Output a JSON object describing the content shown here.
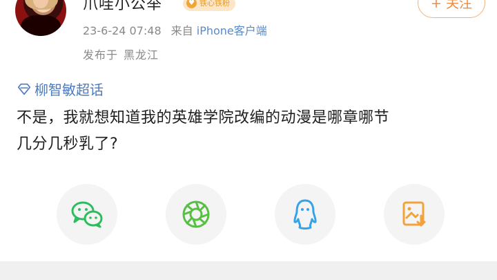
{
  "user": {
    "name": "爪哇小公举",
    "badge": "铁心铁粉"
  },
  "post_meta": {
    "date": "23-6-24 07:48",
    "source_prefix": "来自",
    "source": "iPhone客户端",
    "location_label": "发布于",
    "location": "黑龙江"
  },
  "follow": {
    "label": "+ 关注"
  },
  "topic": {
    "label": "柳智敏超话"
  },
  "post": {
    "line1": "不是，我就想知道我的英雄学院改编的动漫是哪章哪节",
    "line2": "几分几秒乳了?"
  },
  "share_targets": [
    {
      "icon": "wechat-icon",
      "color": "#2dbd5e"
    },
    {
      "icon": "moments-icon",
      "color": "#56c043"
    },
    {
      "icon": "qq-icon",
      "color": "#36a3e8"
    },
    {
      "icon": "save-image-icon",
      "color": "#f1a23a"
    }
  ]
}
